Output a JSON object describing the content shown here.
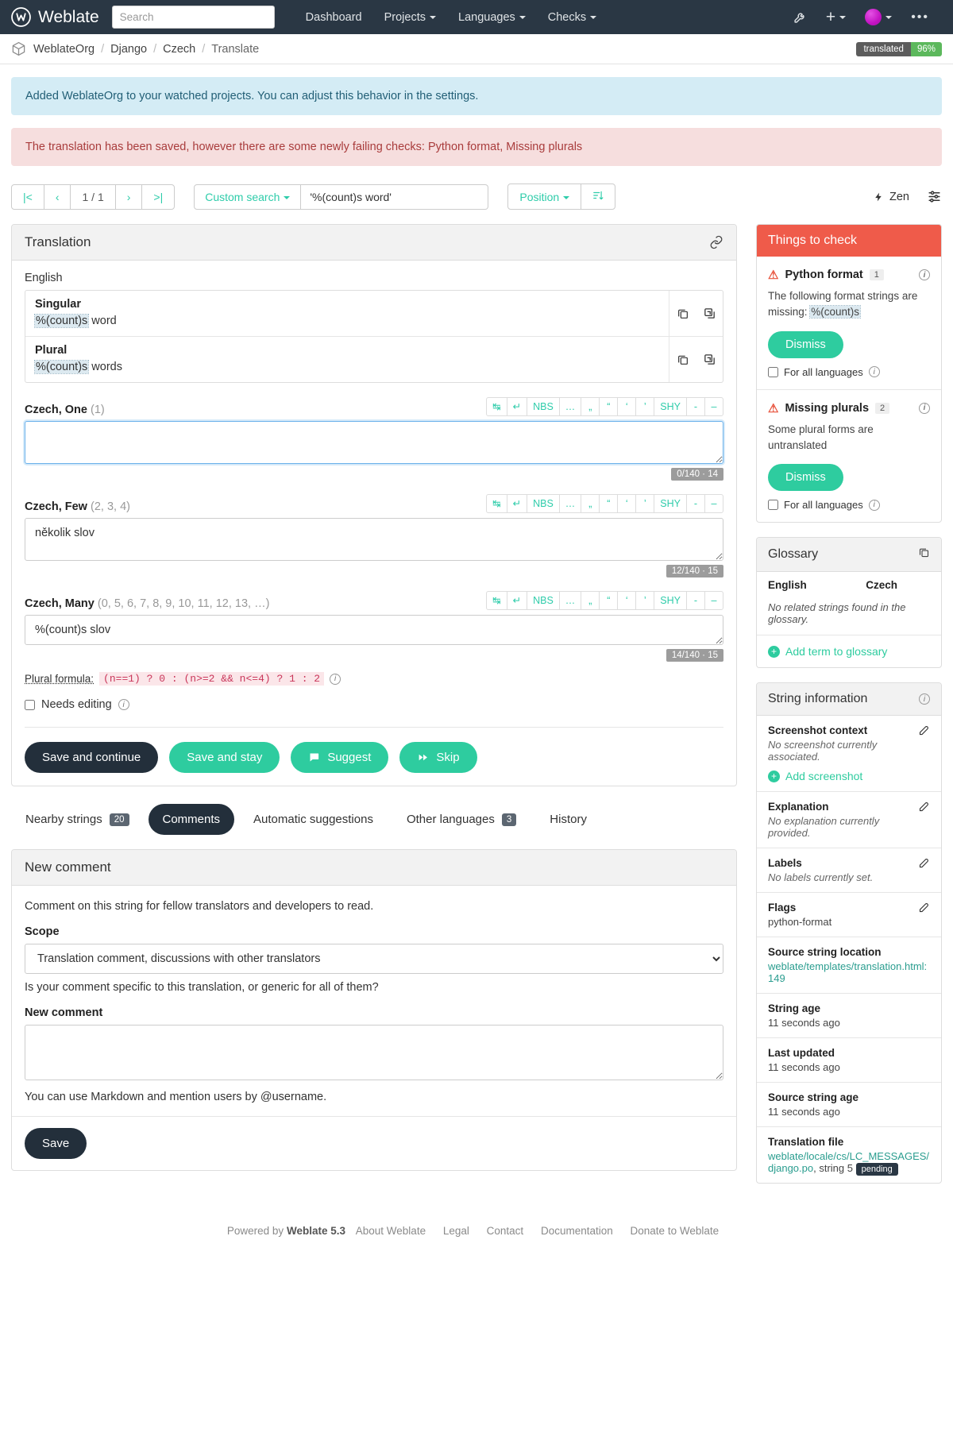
{
  "navbar": {
    "brand": "Weblate",
    "search_placeholder": "Search",
    "links": [
      {
        "label": "Dashboard",
        "caret": false
      },
      {
        "label": "Projects",
        "caret": true
      },
      {
        "label": "Languages",
        "caret": true
      },
      {
        "label": "Checks",
        "caret": true
      }
    ]
  },
  "breadcrumb": {
    "items": [
      "WeblateOrg",
      "Django",
      "Czech",
      "Translate"
    ],
    "badge_label": "translated",
    "badge_value": "96%"
  },
  "alerts": {
    "info": "Added WeblateOrg to your watched projects. You can adjust this behavior in the settings.",
    "danger": "The translation has been saved, however there are some newly failing checks: Python format, Missing plurals"
  },
  "toolbar": {
    "first": "|<",
    "prev": "‹",
    "position": "1 / 1",
    "next": "›",
    "last": ">|",
    "search_dropdown": "Custom search",
    "search_value": "'%(count)s word'",
    "sort_dropdown": "Position",
    "zen_label": "Zen"
  },
  "translation": {
    "panel_title": "Translation",
    "source_language": "English",
    "source_forms": [
      {
        "title": "Singular",
        "format": "%(count)s",
        "rest": " word"
      },
      {
        "title": "Plural",
        "format": "%(count)s",
        "rest": " words"
      }
    ],
    "editor_tools": [
      "↹",
      "↵",
      "NBS",
      "…",
      "„",
      "“",
      "‘",
      "’",
      "SHY",
      "-",
      "–"
    ],
    "targets": [
      {
        "label": "Czech, One",
        "numbers": "(1)",
        "value": "",
        "format": "",
        "rest": "",
        "counter": "0/140 · 14"
      },
      {
        "label": "Czech, Few",
        "numbers": "(2, 3, 4)",
        "value": "několik slov",
        "format": "",
        "rest": "několik slov",
        "counter": "12/140 · 15"
      },
      {
        "label": "Czech, Many",
        "numbers": "(0, 5, 6, 7, 8, 9, 10, 11, 12, 13, …)",
        "value": "%(count)s slov",
        "format": "%(count)s",
        "rest": " slov",
        "counter": "14/140 · 15"
      }
    ],
    "plural_formula_label": "Plural formula:",
    "plural_formula_code": "(n==1) ? 0 : (n>=2 && n<=4) ? 1 : 2",
    "needs_editing": "Needs editing",
    "buttons": {
      "save_continue": "Save and continue",
      "save_stay": "Save and stay",
      "suggest": "Suggest",
      "skip": "Skip"
    }
  },
  "tabs": [
    {
      "label": "Nearby strings",
      "count": "20",
      "active": false
    },
    {
      "label": "Comments",
      "count": "",
      "active": true
    },
    {
      "label": "Automatic suggestions",
      "count": "",
      "active": false
    },
    {
      "label": "Other languages",
      "count": "3",
      "active": false
    },
    {
      "label": "History",
      "count": "",
      "active": false
    }
  ],
  "comment": {
    "panel_title": "New comment",
    "intro": "Comment on this string for fellow translators and developers to read.",
    "scope_label": "Scope",
    "scope_value": "Translation comment, discussions with other translators",
    "scope_help": "Is your comment specific to this translation, or generic for all of them?",
    "new_comment_label": "New comment",
    "markdown_help": "You can use Markdown and mention users by @username.",
    "save_label": "Save"
  },
  "things_to_check": {
    "title": "Things to check",
    "items": [
      {
        "name": "Python format",
        "count": "1",
        "description_prefix": "The following format strings are missing: ",
        "description_code": "%(count)s",
        "dismiss": "Dismiss",
        "for_all": "For all languages"
      },
      {
        "name": "Missing plurals",
        "count": "2",
        "description_prefix": "Some plural forms are untranslated",
        "description_code": "",
        "dismiss": "Dismiss",
        "for_all": "For all languages"
      }
    ]
  },
  "glossary": {
    "title": "Glossary",
    "col_source": "English",
    "col_target": "Czech",
    "empty": "No related strings found in the glossary.",
    "add_link": "Add term to glossary"
  },
  "string_information": {
    "title": "String information",
    "rows": [
      {
        "label": "Screenshot context",
        "value": "No screenshot currently associated.",
        "muted": true,
        "edit": true,
        "link": false
      },
      {
        "label": "",
        "value": "Add screenshot",
        "muted": false,
        "edit": false,
        "link": false,
        "is_add": true
      },
      {
        "label": "Explanation",
        "value": "No explanation currently provided.",
        "muted": true,
        "edit": true,
        "link": false
      },
      {
        "label": "Labels",
        "value": "No labels currently set.",
        "muted": true,
        "edit": true,
        "link": false
      },
      {
        "label": "Flags",
        "value": "python-format",
        "muted": false,
        "edit": true,
        "link": false
      },
      {
        "label": "Source string location",
        "value": "weblate/templates/translation.html:149",
        "muted": false,
        "edit": false,
        "link": true
      },
      {
        "label": "String age",
        "value": "11 seconds ago",
        "muted": false,
        "edit": false,
        "link": false
      },
      {
        "label": "Last updated",
        "value": "11 seconds ago",
        "muted": false,
        "edit": false,
        "link": false
      },
      {
        "label": "Source string age",
        "value": "11 seconds ago",
        "muted": false,
        "edit": false,
        "link": false
      }
    ],
    "translation_file": {
      "label": "Translation file",
      "path": "weblate/locale/cs/LC_MESSAGES/django.po",
      "suffix": ", string 5",
      "badge": "pending"
    }
  },
  "footer": {
    "powered_by": "Powered by",
    "product": "Weblate 5.3",
    "links": [
      "About Weblate",
      "Legal",
      "Contact",
      "Documentation",
      "Donate to Weblate"
    ]
  }
}
